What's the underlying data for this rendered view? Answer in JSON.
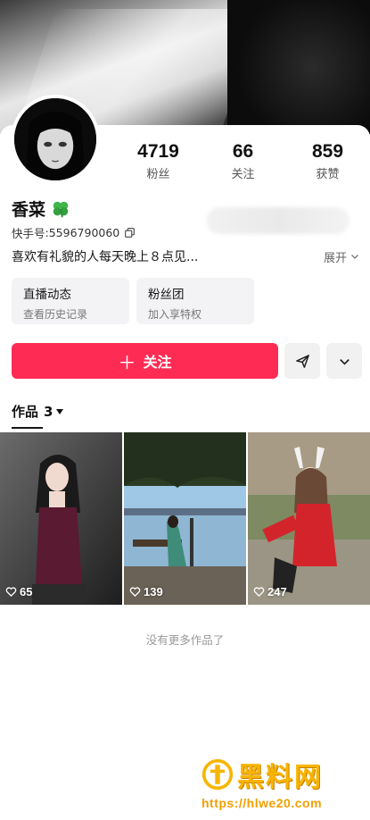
{
  "profile": {
    "name": "香菜",
    "id_label": "快手号",
    "id_value": "5596790060",
    "bio": "喜欢有礼貌的人每天晚上８点见...",
    "expand_label": "展开"
  },
  "stats": [
    {
      "value": "4719",
      "label": "粉丝"
    },
    {
      "value": "66",
      "label": "关注"
    },
    {
      "value": "859",
      "label": "获赞"
    }
  ],
  "cards": [
    {
      "title": "直播动态",
      "subtitle": "查看历史记录"
    },
    {
      "title": "粉丝团",
      "subtitle": "加入享特权"
    }
  ],
  "actions": {
    "follow_label": "关注",
    "share_icon": "send-icon",
    "more_icon": "chevron-down-icon"
  },
  "tabs": {
    "works_label": "作品",
    "works_count": "3"
  },
  "works": [
    {
      "likes": "65"
    },
    {
      "likes": "139"
    },
    {
      "likes": "247"
    }
  ],
  "footer": {
    "no_more": "没有更多作品了"
  },
  "watermark": {
    "brand": "黑料网",
    "url": "https://hlwe20.com"
  },
  "colors": {
    "accent": "#fe2c55",
    "watermark": "#f7b500"
  }
}
